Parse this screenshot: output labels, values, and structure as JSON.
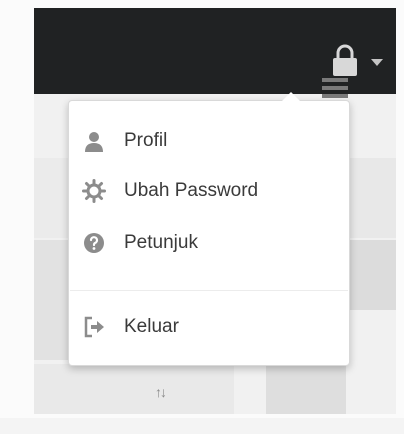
{
  "user_menu": {
    "items": [
      {
        "label": "Profil",
        "icon": "user-icon"
      },
      {
        "label": "Ubah Password",
        "icon": "gear-icon"
      },
      {
        "label": "Petunjuk",
        "icon": "help-icon"
      },
      {
        "label": "Keluar",
        "icon": "logout-icon"
      }
    ]
  },
  "header": {
    "lock_icon": "lock-icon",
    "dropdown_icon": "caret-down-icon"
  },
  "colors": {
    "topbar": "#202223",
    "menu_text": "#3a3a3a",
    "icon": "#8c8c8c"
  }
}
